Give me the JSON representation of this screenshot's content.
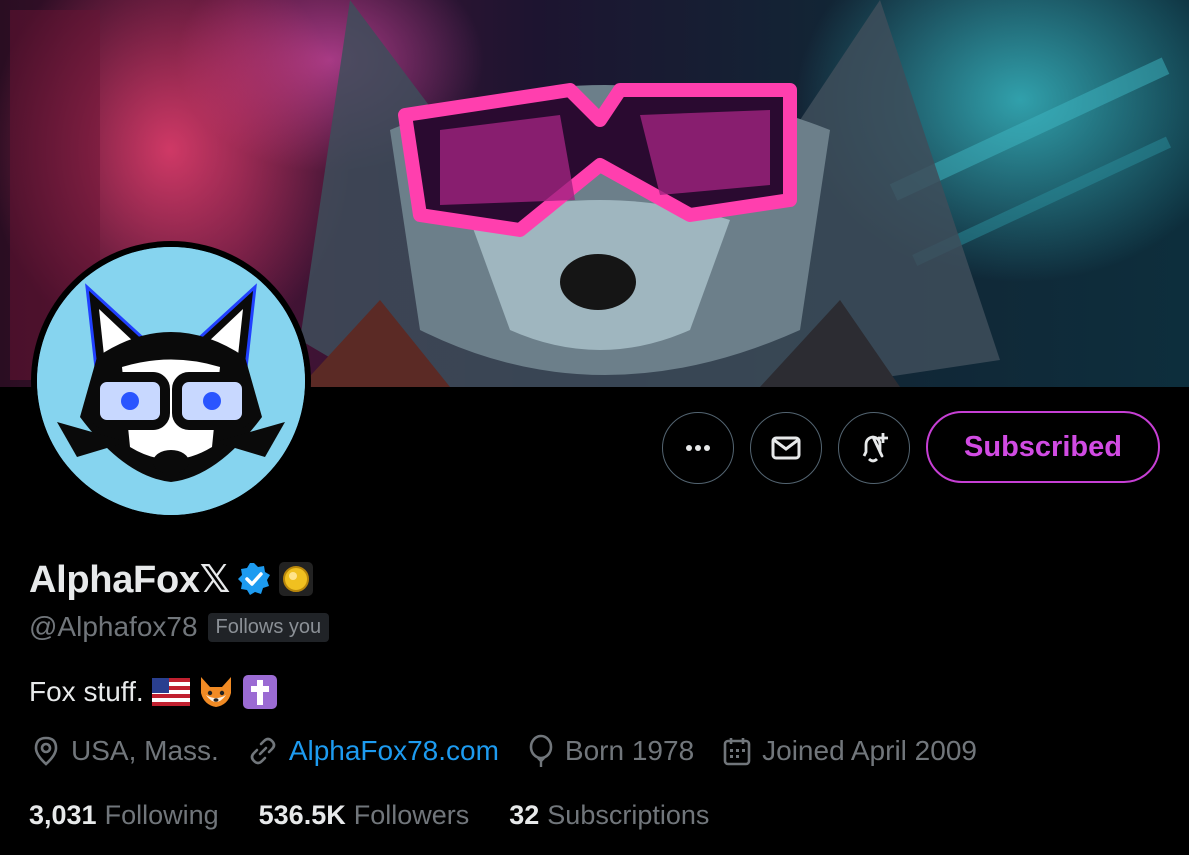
{
  "profile": {
    "display_name": "AlphaFox",
    "x_mark": "𝕏",
    "handle": "@Alphafox78",
    "follows_you": "Follows you",
    "bio_text": "Fox stuff.",
    "location": "USA, Mass.",
    "website": "AlphaFox78.com",
    "born": "Born 1978",
    "joined": "Joined April 2009"
  },
  "actions": {
    "subscribed_label": "Subscribed"
  },
  "stats": {
    "following_count": "3,031",
    "following_label": "Following",
    "followers_count": "536.5K",
    "followers_label": "Followers",
    "subscriptions_count": "32",
    "subscriptions_label": "Subscriptions"
  },
  "colors": {
    "accent": "#1d9bf0",
    "subscribed": "#d14be3",
    "muted": "#71767b",
    "background": "#000000"
  },
  "icons": [
    "more-icon",
    "mail-icon",
    "bell-plus-icon",
    "verified-badge-icon",
    "gold-coin-icon",
    "location-icon",
    "link-icon",
    "balloon-icon",
    "calendar-icon"
  ]
}
